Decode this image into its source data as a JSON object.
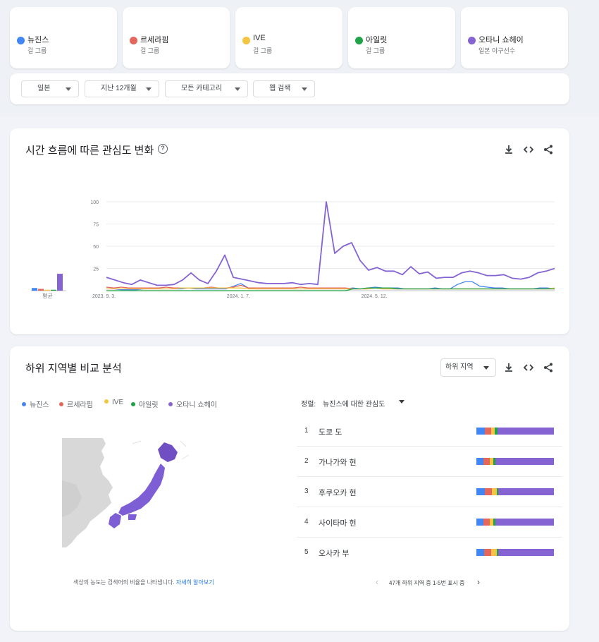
{
  "terms": [
    {
      "name": "뉴진스",
      "category": "걸 그룹",
      "color": "#4285f4"
    },
    {
      "name": "르세라핌",
      "category": "걸 그룹",
      "color": "#e5675b"
    },
    {
      "name": "IVE",
      "category": "걸 그룹",
      "color": "#f4c542"
    },
    {
      "name": "아일릿",
      "category": "걸 그룹",
      "color": "#1ea446"
    },
    {
      "name": "오타니 쇼헤이",
      "category": "일본 야구선수",
      "color": "#8563d3"
    }
  ],
  "filters": {
    "region": "일본",
    "period": "지난 12개월",
    "category": "모든 카테고리",
    "search_type": "웹 검색"
  },
  "interest_over_time": {
    "title": "시간 흐름에 따른 관심도 변화",
    "help_icon": "help-icon",
    "average_label": "평균"
  },
  "chart_data": {
    "type": "line",
    "y_ticks": [
      "100",
      "75",
      "50",
      "25"
    ],
    "ylim": [
      0,
      100
    ],
    "x_labels": [
      "2023. 9. 3.",
      "2024. 1. 7.",
      "2024. 5. 12."
    ],
    "x_label_index": [
      0,
      18,
      36
    ],
    "averages": [
      3,
      2,
      1,
      1,
      19
    ],
    "series": [
      {
        "name": "뉴진스",
        "color": "#4285f4",
        "values": [
          2,
          2,
          1,
          1,
          1,
          2,
          2,
          2,
          2,
          2,
          2,
          3,
          2,
          2,
          2,
          2,
          2,
          5,
          8,
          3,
          2,
          2,
          2,
          2,
          2,
          2,
          2,
          2,
          2,
          2,
          2,
          2,
          2,
          3,
          2,
          3,
          4,
          3,
          3,
          3,
          2,
          2,
          2,
          2,
          3,
          2,
          2,
          7,
          10,
          10,
          5,
          4,
          3,
          3,
          2,
          2,
          2,
          2,
          3,
          3,
          2
        ]
      },
      {
        "name": "르세라핌",
        "color": "#e5675b",
        "values": [
          4,
          3,
          4,
          3,
          3,
          3,
          3,
          3,
          4,
          3,
          3,
          3,
          3,
          3,
          4,
          3,
          3,
          4,
          6,
          3,
          3,
          3,
          3,
          3,
          3,
          3,
          4,
          3,
          3,
          3,
          3,
          3,
          3,
          2,
          2,
          2,
          3,
          2,
          2,
          2,
          2,
          2,
          2,
          2,
          2,
          2,
          2,
          2,
          2,
          2,
          2,
          2,
          2,
          2,
          2,
          2,
          2,
          2,
          2,
          2,
          2
        ]
      },
      {
        "name": "IVE",
        "color": "#f4c542",
        "values": [
          2,
          2,
          2,
          2,
          2,
          2,
          2,
          2,
          2,
          2,
          3,
          3,
          3,
          3,
          3,
          3,
          3,
          3,
          3,
          2,
          2,
          2,
          2,
          2,
          2,
          2,
          2,
          2,
          2,
          2,
          2,
          2,
          2,
          2,
          2,
          2,
          3,
          2,
          2,
          2,
          2,
          2,
          2,
          2,
          2,
          2,
          2,
          2,
          2,
          2,
          2,
          2,
          2,
          2,
          2,
          2,
          2,
          2,
          2,
          2,
          3
        ]
      },
      {
        "name": "아일릿",
        "color": "#1ea446",
        "values": [
          0,
          0,
          0,
          0,
          0,
          0,
          0,
          0,
          0,
          0,
          0,
          0,
          0,
          0,
          0,
          0,
          0,
          0,
          0,
          0,
          0,
          0,
          0,
          0,
          0,
          0,
          0,
          0,
          0,
          0,
          0,
          0,
          0,
          2,
          2,
          3,
          3,
          3,
          3,
          2,
          2,
          2,
          2,
          2,
          2,
          2,
          2,
          2,
          2,
          2,
          2,
          2,
          2,
          2,
          2,
          2,
          2,
          2,
          2,
          2,
          2
        ]
      },
      {
        "name": "오타니 쇼헤이",
        "color": "#8563d3",
        "values": [
          15,
          12,
          9,
          7,
          12,
          9,
          6,
          6,
          7,
          12,
          20,
          12,
          8,
          22,
          40,
          15,
          13,
          11,
          9,
          8,
          8,
          8,
          9,
          7,
          8,
          7,
          100,
          42,
          50,
          54,
          34,
          23,
          26,
          22,
          22,
          18,
          27,
          19,
          21,
          14,
          15,
          15,
          20,
          22,
          20,
          17,
          17,
          18,
          14,
          13,
          15,
          20,
          22,
          25
        ]
      }
    ]
  },
  "subregion": {
    "title": "하위 지역별 비교 분석",
    "dropdown_label": "하위 지역",
    "sort_label": "정렬:",
    "sort_value": "뉴진스에 대한 관심도",
    "map_note": "색상의 농도는 검색어의 비율을 나타냅니다.",
    "map_note_link": "자세히 알아보기",
    "pagination": "47개 하위 지역 중 1-5번 표시 중",
    "rows": [
      {
        "rank": "1",
        "name": "도쿄 도",
        "shares": [
          11,
          8,
          5,
          3,
          73
        ]
      },
      {
        "rank": "2",
        "name": "가나가와 현",
        "shares": [
          9,
          8,
          5,
          3,
          75
        ]
      },
      {
        "rank": "3",
        "name": "후쿠오카 현",
        "shares": [
          11,
          9,
          6,
          2,
          72
        ]
      },
      {
        "rank": "4",
        "name": "사이타마 현",
        "shares": [
          9,
          8,
          5,
          3,
          75
        ]
      },
      {
        "rank": "5",
        "name": "오사카 부",
        "shares": [
          10,
          9,
          7,
          2,
          72
        ]
      }
    ]
  }
}
